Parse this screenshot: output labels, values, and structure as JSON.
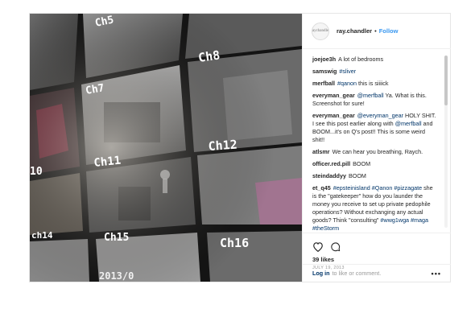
{
  "header": {
    "username": "ray.chandler",
    "separator": "•",
    "follow_label": "Follow",
    "avatar_text": "raychandler"
  },
  "media": {
    "channel_labels": [
      "Ch5",
      "Ch8",
      "Ch7",
      "Ch12",
      "Ch11",
      "10",
      "ch14",
      "Ch15",
      "Ch16"
    ],
    "timestamp_fragment": "2013/0"
  },
  "comments": [
    {
      "user": "joejoe3h",
      "parts": [
        {
          "t": "text",
          "v": "A lot of bedrooms"
        }
      ]
    },
    {
      "user": "samswig",
      "parts": [
        {
          "t": "tag",
          "v": "#sliver"
        }
      ]
    },
    {
      "user": "merfball",
      "parts": [
        {
          "t": "tag",
          "v": "#qanon"
        },
        {
          "t": "text",
          "v": " this is siiiick"
        }
      ]
    },
    {
      "user": "everyman_gear",
      "parts": [
        {
          "t": "mention",
          "v": "@merfball"
        },
        {
          "t": "text",
          "v": " Ya. What is this. Screenshot for sure!"
        }
      ]
    },
    {
      "user": "everyman_gear",
      "parts": [
        {
          "t": "mention",
          "v": "@everyman_gear"
        },
        {
          "t": "text",
          "v": " HOLY SHIT. I see this post earlier along with "
        },
        {
          "t": "mention",
          "v": "@merfball"
        },
        {
          "t": "text",
          "v": " and BOOM...it's on Q's post!! This is some weird shit!!"
        }
      ]
    },
    {
      "user": "atlsmr",
      "parts": [
        {
          "t": "text",
          "v": "We can hear you breathing, Raych."
        }
      ]
    },
    {
      "user": "officer.red.pill",
      "parts": [
        {
          "t": "text",
          "v": "BOOM"
        }
      ]
    },
    {
      "user": "steindaddyy",
      "parts": [
        {
          "t": "text",
          "v": "BOOM"
        }
      ]
    },
    {
      "user": "et_q45",
      "parts": [
        {
          "t": "tag",
          "v": "#epsteinisland"
        },
        {
          "t": "text",
          "v": " "
        },
        {
          "t": "tag",
          "v": "#Qanon"
        },
        {
          "t": "text",
          "v": " "
        },
        {
          "t": "tag",
          "v": "#pizzagate"
        },
        {
          "t": "text",
          "v": " she is the \"gatekeeper\" how do you launder the money you receive to set up private pedophile operations? Without exchanging any actual goods? Think \"consulting\" "
        },
        {
          "t": "tag",
          "v": "#wwg1wga #maga #theStorm"
        }
      ]
    }
  ],
  "actions": {
    "likes": "39 likes",
    "date": "JULY 19, 2013",
    "login_link": "Log in",
    "login_rest": "to like or comment.",
    "more_label": "•••"
  },
  "icons": [
    "heart-icon",
    "comment-icon",
    "more-options-icon"
  ],
  "colors": {
    "link": "#003569",
    "follow": "#3897f0",
    "text": "#262626",
    "muted": "#999999"
  }
}
